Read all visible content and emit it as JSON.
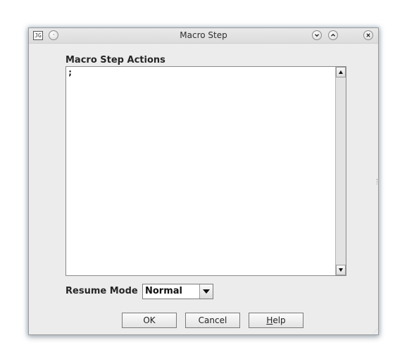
{
  "window": {
    "title": "Macro Step",
    "app_icon_text": "JG",
    "controls": {
      "menu_icon": "circle-menu-icon",
      "minimize_icon": "chevron-down-circle-icon",
      "maximize_icon": "chevron-up-circle-icon",
      "close_icon": "close-x-icon"
    }
  },
  "actions": {
    "label": "Macro Step Actions",
    "text": ";"
  },
  "resume": {
    "label": "Resume Mode",
    "selected": "Normal"
  },
  "buttons": {
    "ok": "OK",
    "cancel": "Cancel",
    "help_mnemonic": "H",
    "help_rest": "elp"
  }
}
